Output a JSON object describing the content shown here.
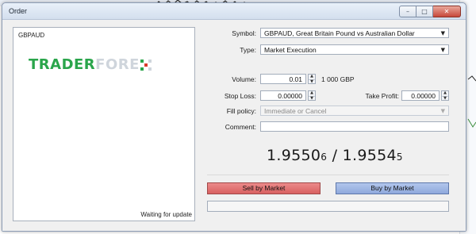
{
  "window": {
    "title": "Order",
    "controls": {
      "minimize": "–",
      "maximize": "□",
      "close": "✕"
    }
  },
  "chart_panel": {
    "symbol": "GBPAUD",
    "logo_trader": "TRADER",
    "logo_fore": "FORE",
    "status": "Waiting for update"
  },
  "form": {
    "symbol_label": "Symbol:",
    "symbol_value": "GBPAUD, Great Britain Pound vs Australian Dollar",
    "type_label": "Type:",
    "type_value": "Market Execution",
    "volume_label": "Volume:",
    "volume_value": "0.01",
    "volume_unit": "1 000 GBP",
    "stop_loss_label": "Stop Loss:",
    "stop_loss_value": "0.00000",
    "take_profit_label": "Take Profit:",
    "take_profit_value": "0.00000",
    "fill_policy_label": "Fill policy:",
    "fill_policy_value": "Immediate or Cancel",
    "comment_label": "Comment:",
    "comment_value": ""
  },
  "quote": {
    "bid_main": "1.9550",
    "bid_small": "6",
    "separator": " / ",
    "ask_main": "1.9554",
    "ask_small": "5"
  },
  "buttons": {
    "sell": "Sell by Market",
    "buy": "Buy by Market"
  },
  "progress": {
    "level": 0
  },
  "colors": {
    "sell": "#d86060",
    "buy": "#8fa9dc",
    "logo_green": "#2aa54b",
    "logo_accent_red": "#d93a2b"
  },
  "icons": {
    "spin_up": "spin-up-icon",
    "spin_down": "spin-down-icon",
    "dropdown": "chevron-down-icon"
  }
}
